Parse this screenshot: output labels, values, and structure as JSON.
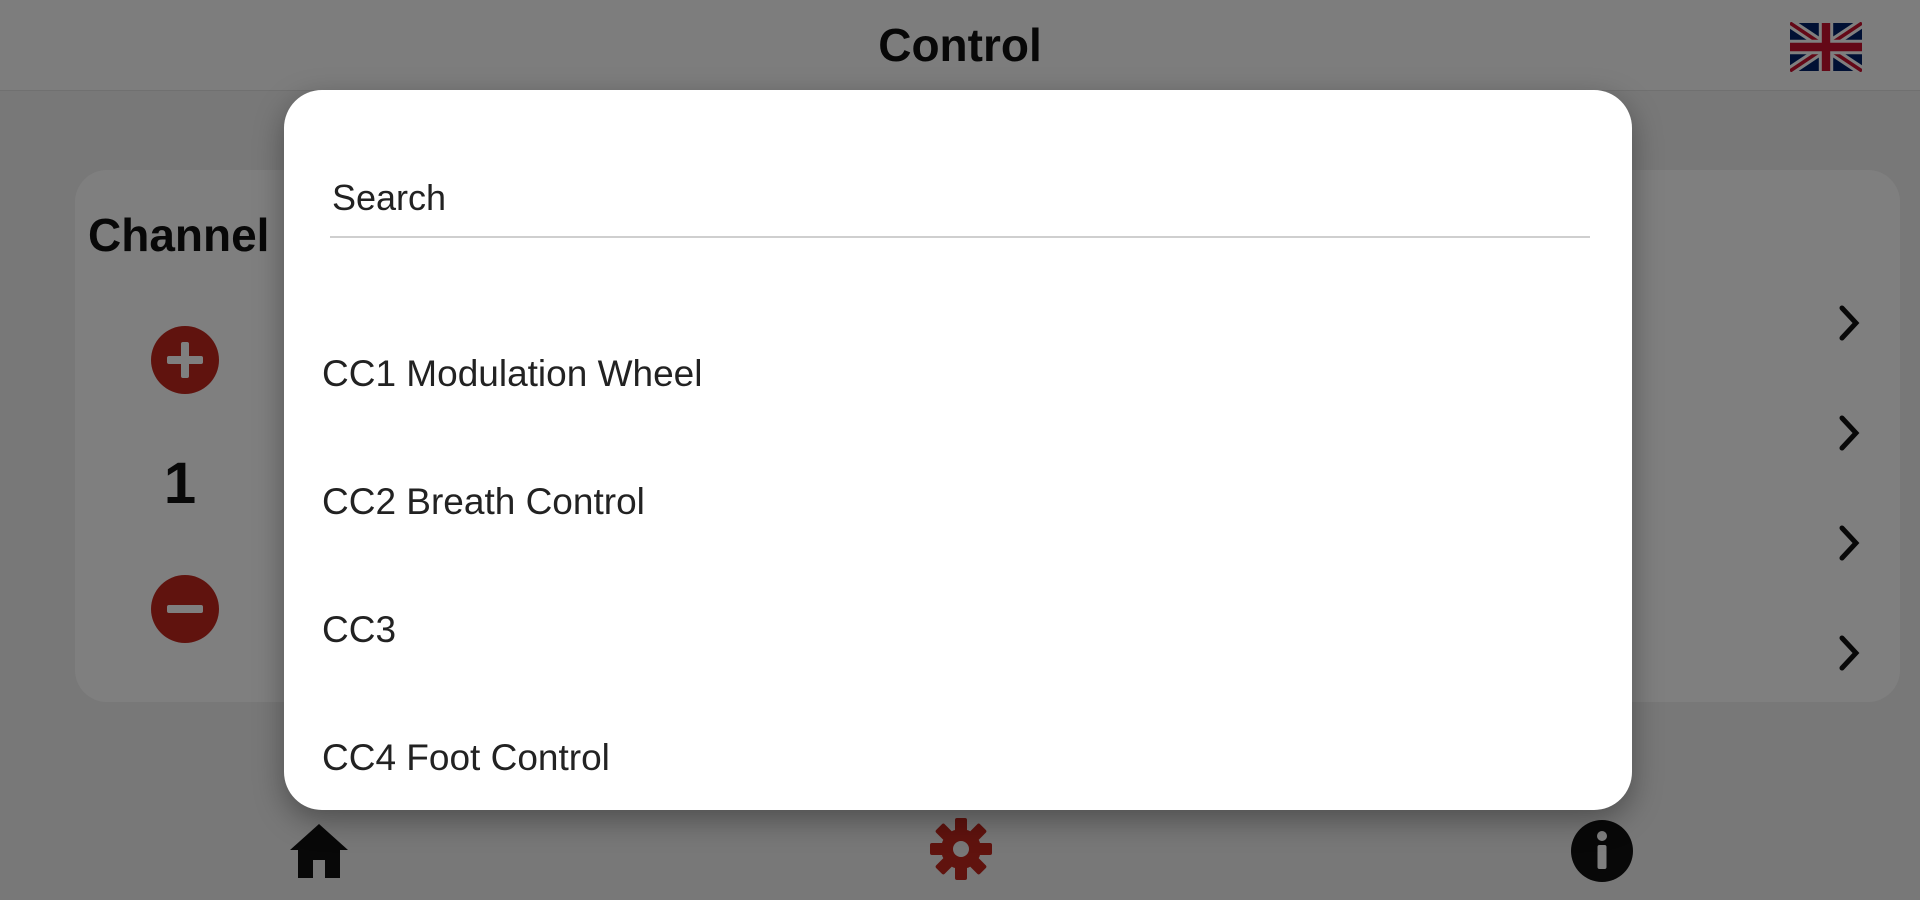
{
  "header": {
    "title": "Control",
    "language_icon": "uk-flag-icon"
  },
  "channel": {
    "label": "Channel",
    "value": "1",
    "increment_icon": "plus-circle-icon",
    "decrement_icon": "minus-circle-icon"
  },
  "rows": [
    {
      "icon": "chevron-right-icon"
    },
    {
      "icon": "chevron-right-icon"
    },
    {
      "icon": "chevron-right-icon"
    },
    {
      "icon": "chevron-right-icon"
    }
  ],
  "bottom_nav": {
    "items": [
      {
        "icon": "home-icon",
        "active": false
      },
      {
        "icon": "gear-icon",
        "active": true
      },
      {
        "icon": "info-icon",
        "active": false
      }
    ]
  },
  "dialog": {
    "search_placeholder": "Search",
    "search_value": "",
    "options": [
      "CC1 Modulation Wheel",
      "CC2 Breath Control",
      "CC3",
      "CC4 Foot Control"
    ]
  },
  "colors": {
    "accent": "#c0261d",
    "text": "#111111",
    "scrim": "rgba(0,0,0,0.5)"
  }
}
